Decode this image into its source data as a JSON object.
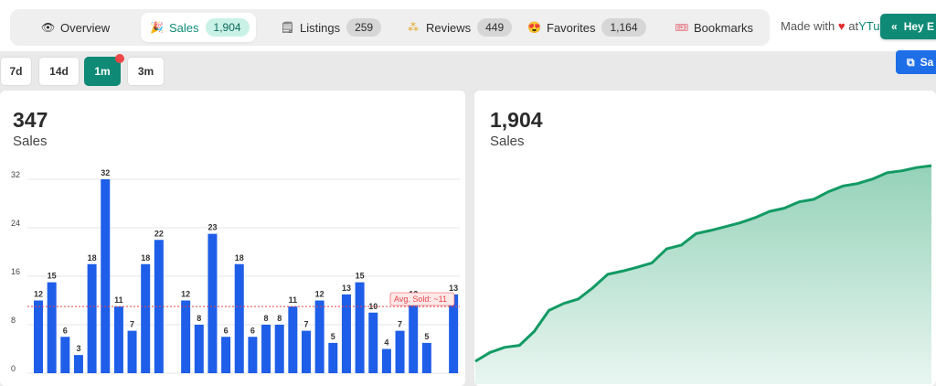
{
  "tabs": [
    {
      "label": "Overview",
      "icon": "eye-icon",
      "badge": null
    },
    {
      "label": "Sales",
      "icon": "party-popper-icon",
      "badge": "1,904"
    },
    {
      "label": "Listings",
      "icon": "notepad-icon",
      "badge": "259"
    },
    {
      "label": "Reviews",
      "icon": "stars-icon",
      "badge": "449"
    },
    {
      "label": "Favorites",
      "icon": "heart-eyes-icon",
      "badge": "1,164"
    },
    {
      "label": "Bookmarks",
      "icon": "bookmark-ticket-icon",
      "badge": null
    }
  ],
  "active_tab": "Sales",
  "made_with": {
    "prefix": "Made with",
    "heart": "♥",
    "at": "at",
    "brand": "YTu"
  },
  "hey_button": {
    "label": "Hey E"
  },
  "save_button": {
    "label": "Sa"
  },
  "time_ranges": [
    "7d",
    "14d",
    "1m",
    "3m"
  ],
  "active_range": "1m",
  "left_card": {
    "value": "347",
    "label": "Sales"
  },
  "right_card": {
    "value": "1,904",
    "label": "Sales"
  },
  "colors": {
    "accent": "#0e8a76",
    "bar": "#1e5ee8",
    "line": "#129a63",
    "avg_line": "#e8424a",
    "area": "#cdeadf"
  },
  "chart_data": [
    {
      "type": "bar",
      "values": [
        12,
        15,
        6,
        3,
        18,
        32,
        11,
        7,
        18,
        22,
        0,
        12,
        8,
        23,
        6,
        18,
        6,
        8,
        8,
        11,
        7,
        12,
        5,
        13,
        15,
        10,
        4,
        7,
        12,
        5,
        0,
        13
      ],
      "yticks": [
        "0",
        "8",
        "16",
        "24",
        "32"
      ],
      "ylim": [
        0,
        32
      ],
      "annotation": "Avg. Sold: ~11",
      "average": 11,
      "grid": true
    },
    {
      "type": "area",
      "values": [
        1596,
        1610,
        1618,
        1621,
        1643,
        1676,
        1687,
        1694,
        1712,
        1733,
        1738,
        1744,
        1751,
        1773,
        1779,
        1797,
        1802,
        1808,
        1814,
        1822,
        1832,
        1837,
        1847,
        1851,
        1863,
        1872,
        1876,
        1883,
        1893,
        1896,
        1901,
        1904
      ],
      "ylim": [
        1560,
        1920
      ],
      "grid": false
    }
  ]
}
